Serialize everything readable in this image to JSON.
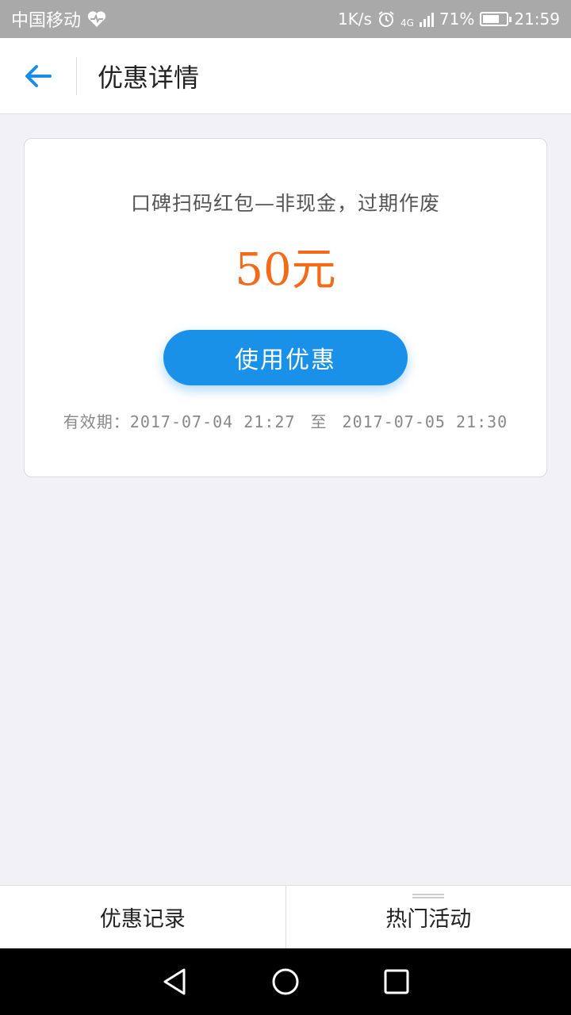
{
  "status": {
    "carrier": "中国移动",
    "speed": "1K/s",
    "network": "4G",
    "battery": "71%",
    "battery_level": 0.71,
    "time": "21:59"
  },
  "header": {
    "title": "优惠详情",
    "back_icon": "arrow-left-icon"
  },
  "coupon": {
    "description": "口碑扫码红包—非现金，过期作废",
    "amount": "50元",
    "use_label": "使用优惠",
    "validity_label": "有效期：",
    "start": "2017-07-04 21:27",
    "separator": "至",
    "end": "2017-07-05 21:30",
    "accent_color": "#f36a18",
    "button_color": "#1a91e8"
  },
  "tabs": [
    {
      "label": "优惠记录"
    },
    {
      "label": "热门活动"
    }
  ]
}
